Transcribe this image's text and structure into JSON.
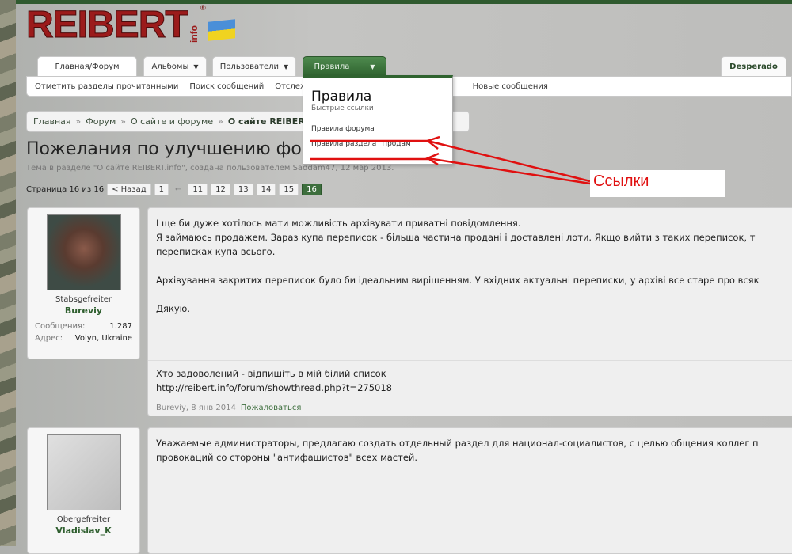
{
  "logo": {
    "text": "REIBERT",
    "suffix": "info",
    "mark": "®"
  },
  "tabs": [
    {
      "label": "Главная/Форум"
    },
    {
      "label": "Альбомы"
    },
    {
      "label": "Пользователи"
    },
    {
      "label": "Правила"
    }
  ],
  "user_tab": "Desperado",
  "subnav": [
    "Отметить разделы прочитанными",
    "Поиск сообщений",
    "Отслеживае",
    "Новые сообщения"
  ],
  "dropdown": {
    "title": "Правила",
    "subtitle": "Быстрые ссылки",
    "links": [
      "Правила форума",
      "Правила раздела \"Продам\""
    ]
  },
  "breadcrumb": [
    "Главная",
    "Форум",
    "О сайте и форуме",
    "О сайте REIBERT.info"
  ],
  "thread": {
    "title": "Пожелания по улучшению форума",
    "subtitle": "Тема в разделе \"О сайте REIBERT.info\", создана пользователем Saddam47, 12 мар 2013."
  },
  "pager": {
    "label": "Страница 16 из 16",
    "prev": "< Назад",
    "pages": [
      "1",
      "←",
      "11",
      "12",
      "13",
      "14",
      "15",
      "16"
    ],
    "current": "16"
  },
  "posts": [
    {
      "rank": "Stabsgefreiter",
      "user": "Bureviy",
      "stats": [
        {
          "k": "Сообщения:",
          "v": "1.287"
        },
        {
          "k": "Адрес:",
          "v": "Volyn, Ukraine"
        }
      ],
      "lines": [
        "І ще би дуже хотілось мати можливість архівувати приватні повідомлення.",
        "Я займаюсь продажем. Зараз купа переписок - більша частина продані і доставлені лоти. Якщо вийти з таких переписок, т",
        "переписках купа всього.",
        "",
        "Архівування закритих переписок було би ідеальним вирішенням. У вхідних актуальні переписки, у архіві все старе про всяк",
        "",
        "Дякую."
      ],
      "signature": [
        "Хто задоволений - відпишіть в мій білий список",
        "http://reibert.info/forum/showthread.php?t=275018"
      ],
      "meta": "Bureviy, 8 янв 2014",
      "report": "Пожаловаться"
    },
    {
      "rank": "Obergefreiter",
      "user": "Vladislav_K",
      "lines": [
        "Уважаемые администраторы, предлагаю создать отдельный раздел для национал-социалистов, с целью общения коллег п",
        "провокаций со стороны \"антифашистов\" всех мастей."
      ]
    }
  ],
  "annotation": {
    "label": "Ссылки",
    "color": "#e01010"
  }
}
